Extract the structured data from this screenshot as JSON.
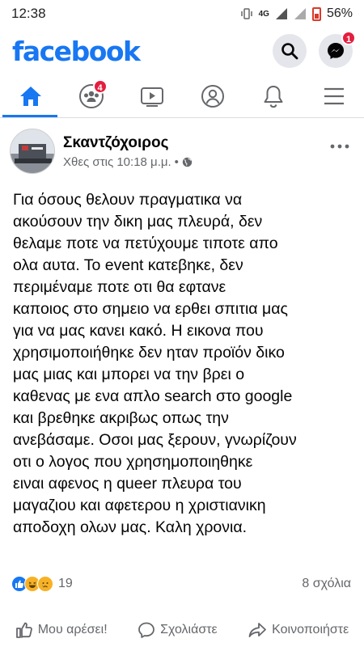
{
  "status_bar": {
    "time": "12:38",
    "network": "4G",
    "battery": "56%"
  },
  "header": {
    "logo": "facebook",
    "messenger_badge": "1"
  },
  "nav": {
    "groups_badge": "4",
    "active_tab": "home"
  },
  "post": {
    "author": "Σκαντζόχοιρος",
    "timestamp": "Χθες στις 10:18 μ.μ.",
    "separator": "•",
    "text": "Για όσους θελουν πραγματικα να\nακούσουν την δικη μας πλευρά, δεν\nθελαμε ποτε να πετύχουμε τιποτε απο\nολα αυτα. Το event κατεβηκε, δεν\nπεριμέναμε ποτε οτι θα εφτανε\nκαποιος στο σημειο να ερθει σπιτια μας\nγια να μας κανει κακό. Η εικονα που\nχρησιμοποιήθηκε δεν ηταν προϊόν δικο\nμας μιας και μπορει να την βρει ο\nκαθενας με ενα απλο search στο google\nκαι βρεθηκε ακριβως οπως την\nανεβάσαμε. Οσοι μας ξερουν, γνωρίζουν\nοτι ο  λογος που χρησημοποιηθηκε\nειναι αφενος η queer πλευρα του\nμαγαζιου και αφετερου η χριστιανικη\nαποδοχη ολων μας. Καλη  χρονια.",
    "reaction_count": "19",
    "comments": "8 σχόλια"
  },
  "actions": {
    "like": "Μου αρέσει!",
    "comment": "Σχολιάστε",
    "share": "Κοινοποιήστε"
  },
  "colors": {
    "brand": "#1877f2",
    "badge": "#e41e3f",
    "icon_gray": "#65676b"
  }
}
